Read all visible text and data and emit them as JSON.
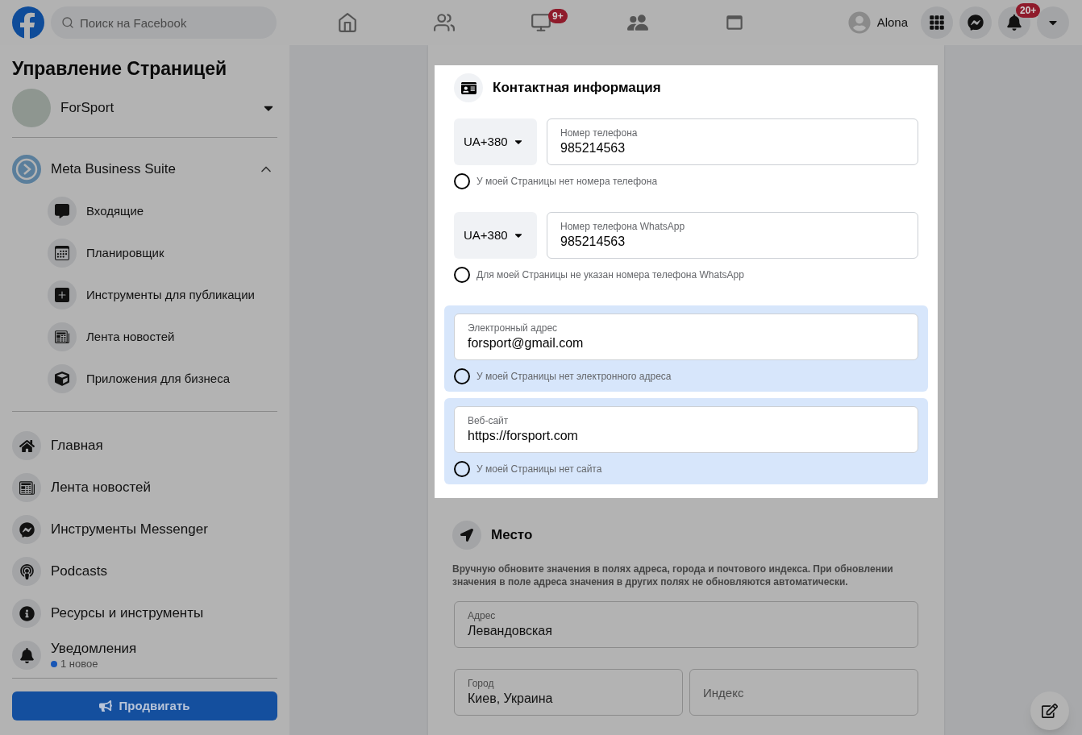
{
  "topbar": {
    "search": {
      "placeholder": "Поиск на Facebook"
    },
    "video_tab": {
      "badge": "9+"
    },
    "profile": {
      "name": "Alona"
    },
    "notifications_button": {
      "badge": "20+"
    }
  },
  "sidebar": {
    "title": "Управление Страницей",
    "page": {
      "name": "ForSport"
    },
    "suite": {
      "label": "Meta Business Suite",
      "expanded": true,
      "children": [
        {
          "label": "Входящие"
        },
        {
          "label": "Планировщик"
        },
        {
          "label": "Инструменты для публикации"
        },
        {
          "label": "Лента новостей"
        },
        {
          "label": "Приложения для бизнеса"
        }
      ]
    },
    "items": [
      {
        "label": "Главная"
      },
      {
        "label": "Лента новостей"
      },
      {
        "label": "Инструменты Messenger"
      },
      {
        "label": "Podcasts"
      },
      {
        "label": "Ресурсы и инструменты"
      },
      {
        "label": "Уведомления",
        "note": "1 новое"
      }
    ],
    "promote_button": "Продвигать"
  },
  "contact": {
    "title": "Контактная информация",
    "fields": [
      {
        "kind": "phone",
        "highlighted": false,
        "country": "UA+380",
        "label": "Номер телефона",
        "value": "985214563",
        "option": {
          "label": "У моей Страницы нет номера телефона",
          "checked": false
        }
      },
      {
        "kind": "phone",
        "highlighted": false,
        "country": "UA+380",
        "label": "Номер телефона WhatsApp",
        "value": "985214563",
        "option": {
          "label": "Для моей Страницы не указан номера телефона WhatsApp",
          "checked": false
        }
      },
      {
        "kind": "text",
        "highlighted": true,
        "label": "Электронный адрес",
        "value": "forsport@gmail.com",
        "option": {
          "label": "У моей Страницы нет электронного адреса",
          "checked": false
        }
      },
      {
        "kind": "text",
        "highlighted": true,
        "label": "Веб-сайт",
        "value": "https://forsport.com",
        "option": {
          "label": "У моей Страницы нет сайта",
          "checked": false
        }
      }
    ]
  },
  "place": {
    "title": "Место",
    "description": "Вручную обновите значения в полях адреса, города и почтового индекса. При обновлении значения в поле адреса значения в других полях не обновляются автоматически.",
    "address": {
      "label": "Адрес",
      "value": "Левандовская"
    },
    "city": {
      "label": "Город",
      "value": "Киев, Украина"
    },
    "zip": {
      "placeholder": "Индекс"
    }
  }
}
